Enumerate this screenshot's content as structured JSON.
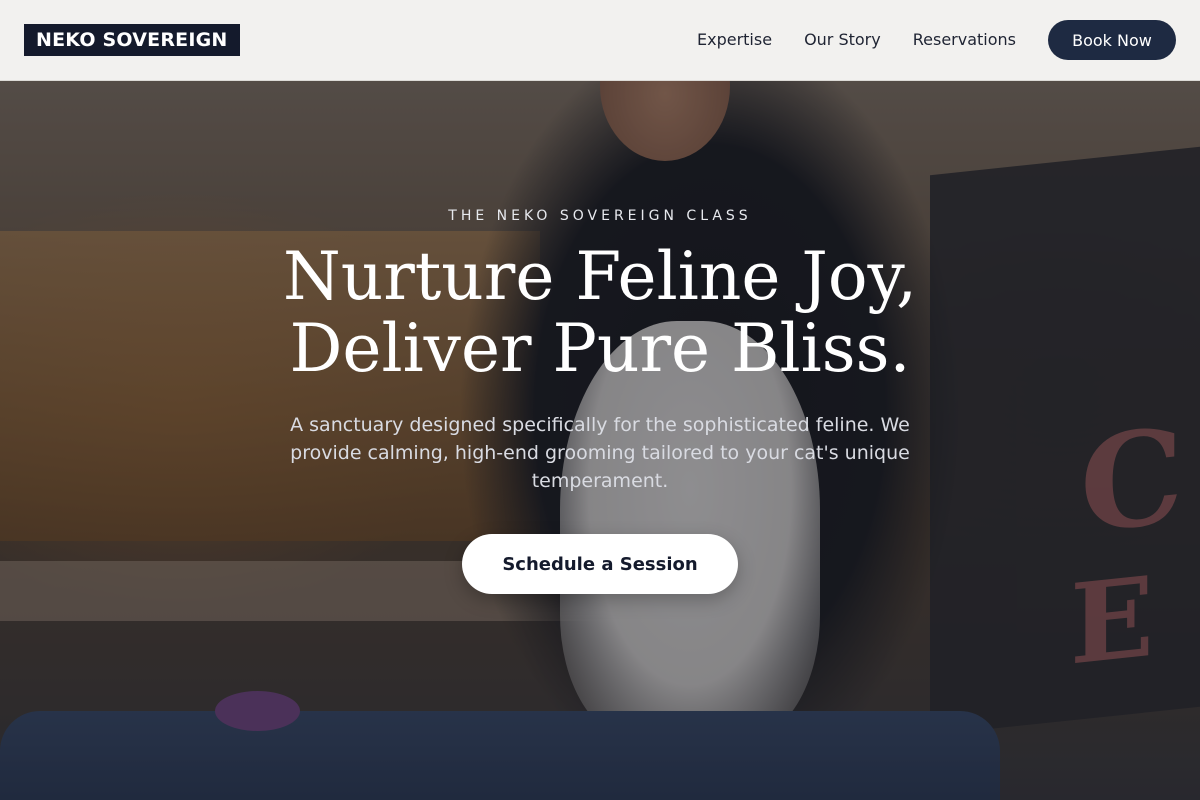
{
  "brand": {
    "name": "NEKO SOVEREIGN"
  },
  "nav": {
    "items": [
      {
        "label": "Expertise"
      },
      {
        "label": "Our Story"
      },
      {
        "label": "Reservations"
      }
    ],
    "cta_label": "Book Now"
  },
  "hero": {
    "eyebrow": "THE NEKO SOVEREIGN CLASS",
    "headline_line1": "Nurture Feline Joy,",
    "headline_line2": "Deliver Pure Bliss.",
    "subtitle": "A sanctuary designed specifically for the sophisticated feline. We provide calming, high-end grooming tailored to your cat's unique temperament.",
    "cta_label": "Schedule a Session"
  },
  "colors": {
    "brand_navy": "#141a2c",
    "button_navy": "#1e2a42",
    "header_bg": "#f2f1ef",
    "cta_bg": "#ffffff"
  }
}
